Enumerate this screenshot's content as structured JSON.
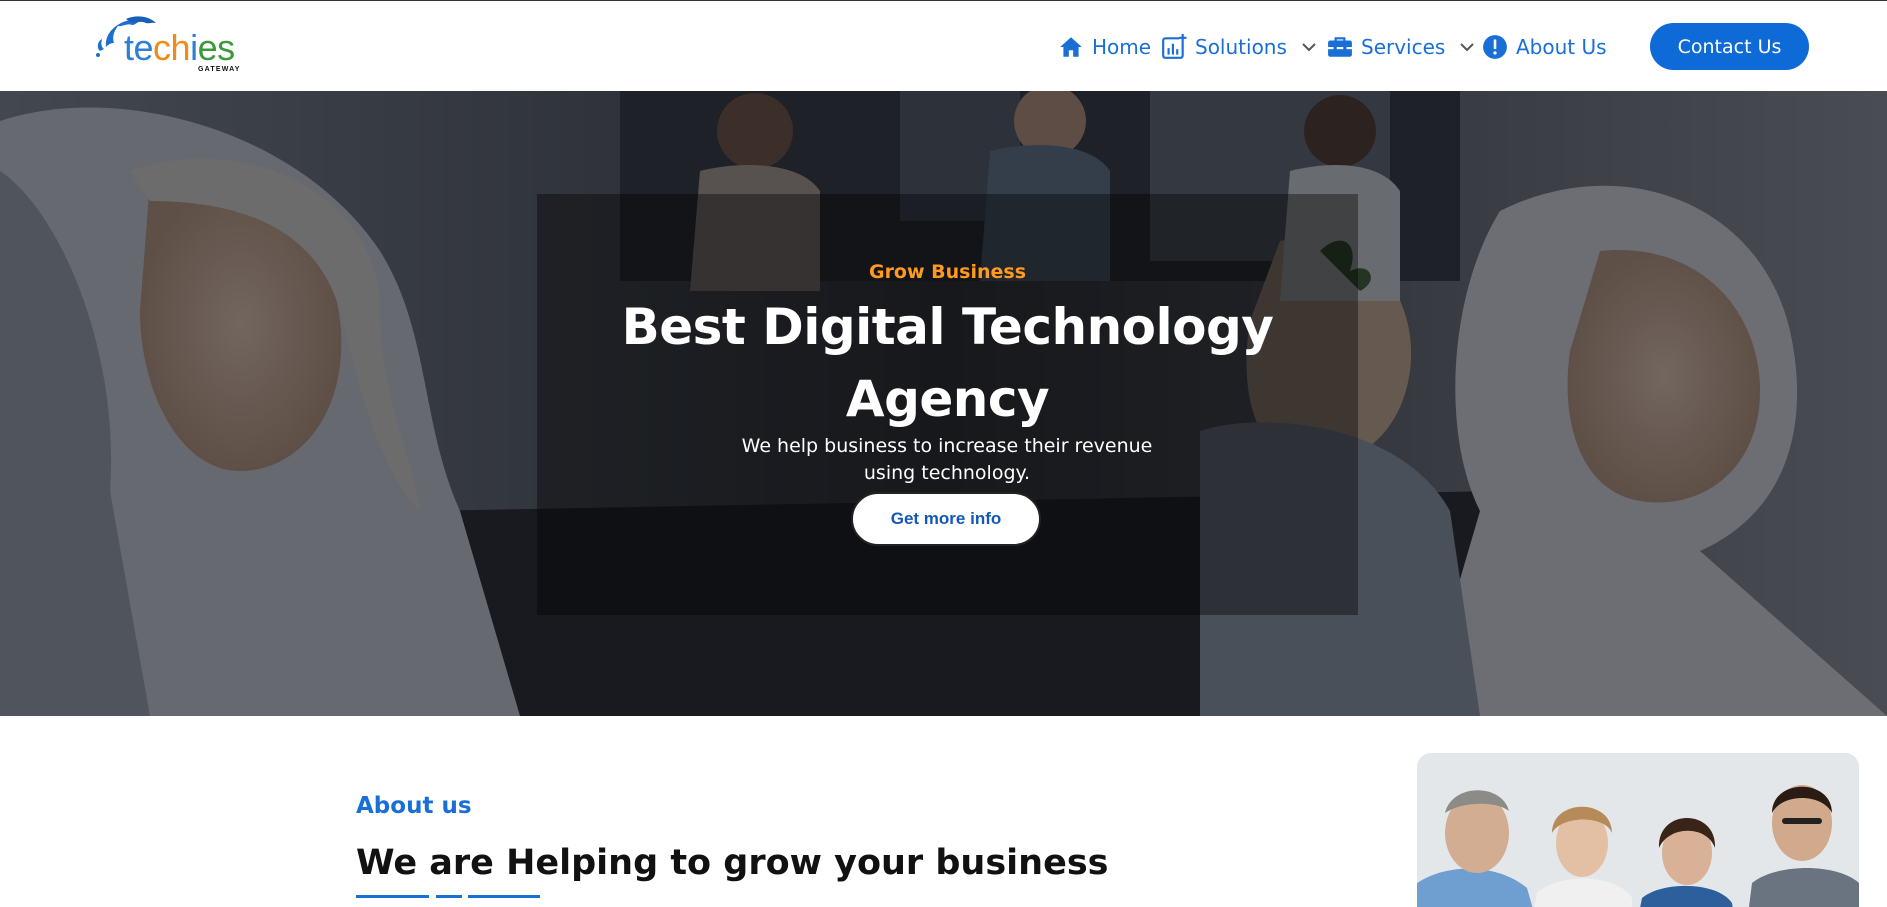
{
  "header": {
    "logo": {
      "text_parts": [
        "te",
        "ch",
        "i",
        "es"
      ],
      "subtext": "GATEWAY"
    },
    "nav": [
      {
        "label": "Home",
        "icon": "home-icon",
        "has_dropdown": false
      },
      {
        "label": "Solutions",
        "icon": "chart-add-icon",
        "has_dropdown": true
      },
      {
        "label": "Services",
        "icon": "toolbox-icon",
        "has_dropdown": true
      },
      {
        "label": "About Us",
        "icon": "info-circle-icon",
        "has_dropdown": false
      }
    ],
    "cta_label": "Contact Us"
  },
  "hero": {
    "eyebrow": "Grow Business",
    "title": "Best Digital Technology Agency",
    "description": "We help business to increase their revenue using technology.",
    "button_label": "Get more info",
    "background": "team-meeting-photo"
  },
  "about": {
    "eyebrow": "About us",
    "title": "We are Helping to grow your business",
    "image": "team-photo"
  },
  "colors": {
    "brand_blue": "#0d6ad6",
    "accent_orange": "#ff9a1f",
    "link_blue": "#1a6fd6",
    "logo_green": "#3a9a3a"
  }
}
